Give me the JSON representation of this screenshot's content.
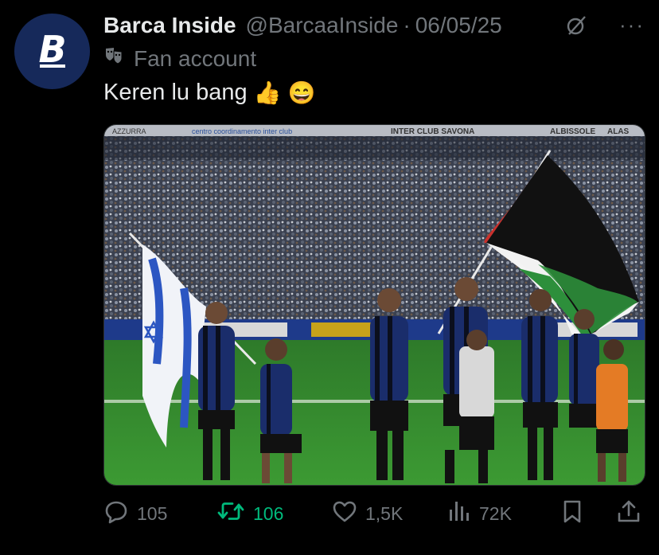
{
  "author": {
    "name": "Barca Inside",
    "handle": "@BarcaaInside",
    "separator": "·",
    "date": "06/05/25",
    "avatar_letter": "B",
    "label": "Fan account",
    "label_icon": "theater-masks-icon"
  },
  "tweet": {
    "text": "Keren lu bang",
    "emojis": [
      "👍",
      "😄"
    ]
  },
  "media": {
    "description_icon": "stadium-photo",
    "banner_texts": [
      "AZZURRA",
      "centro coordinamento inter club",
      "INTER CLUB SAVONA",
      "ALBISSOLE",
      "ALAS"
    ]
  },
  "actions": {
    "replies": "105",
    "retweets": "106",
    "likes": "1,5K",
    "views": "72K"
  },
  "colors": {
    "background": "#000000",
    "text": "#e7e9ea",
    "muted": "#71767b",
    "retweet_active": "#00ba7c",
    "avatar_bg": "#16295a"
  }
}
